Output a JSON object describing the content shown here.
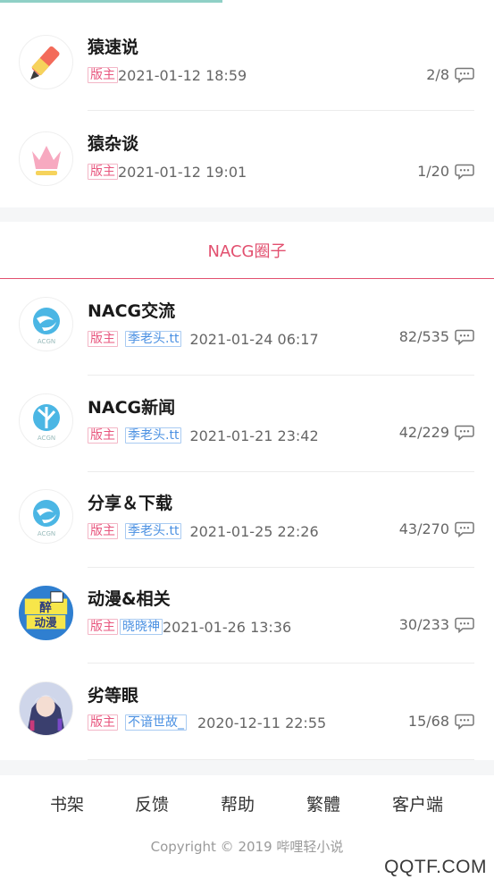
{
  "forums_top": [
    {
      "title": "猿速说",
      "mod_tag": "版主",
      "datetime": "2021-01-12 18:59",
      "stats": "2/8",
      "icon": "pencil-icon"
    },
    {
      "title": "猿杂谈",
      "mod_tag": "版主",
      "datetime": "2021-01-12 19:01",
      "stats": "1/20",
      "icon": "crown-icon"
    }
  ],
  "section": {
    "title": "NACG圈子"
  },
  "forums_nacg": [
    {
      "title": "NACG交流",
      "mod_tag": "版主",
      "user_tag": "季老头.tt",
      "datetime": "2021-01-24 06:17",
      "stats": "82/535",
      "icon": "acgn-logo-icon"
    },
    {
      "title": "NACG新闻",
      "mod_tag": "版主",
      "user_tag": "季老头.tt",
      "datetime": "2021-01-21 23:42",
      "stats": "42/229",
      "icon": "acgn-logo-icon"
    },
    {
      "title": "分享＆下载",
      "mod_tag": "版主",
      "user_tag": "季老头.tt",
      "datetime": "2021-01-25 22:26",
      "stats": "43/270",
      "icon": "acgn-logo-icon"
    },
    {
      "title": "动漫&相关",
      "mod_tag": "版主",
      "user_tag": "晓晓神",
      "datetime": "2021-01-26 13:36",
      "stats": "30/233",
      "icon": "anime-sticker-icon"
    },
    {
      "title": "劣等眼",
      "mod_tag": "版主",
      "user_tag": "不谙世故_",
      "datetime": "2020-12-11 22:55",
      "stats": "15/68",
      "icon": "anime-character-icon"
    }
  ],
  "footer": {
    "nav": [
      "书架",
      "反馈",
      "帮助",
      "繁體",
      "客户端"
    ],
    "copyright": "Copyright © 2019 哔哩轻小说"
  },
  "watermark": "QQTF.COM",
  "colors": {
    "accent": "#e2506f",
    "tag_red": "#e8567e",
    "tag_blue": "#4a90e2",
    "top_bar": "#8fd0c6"
  }
}
